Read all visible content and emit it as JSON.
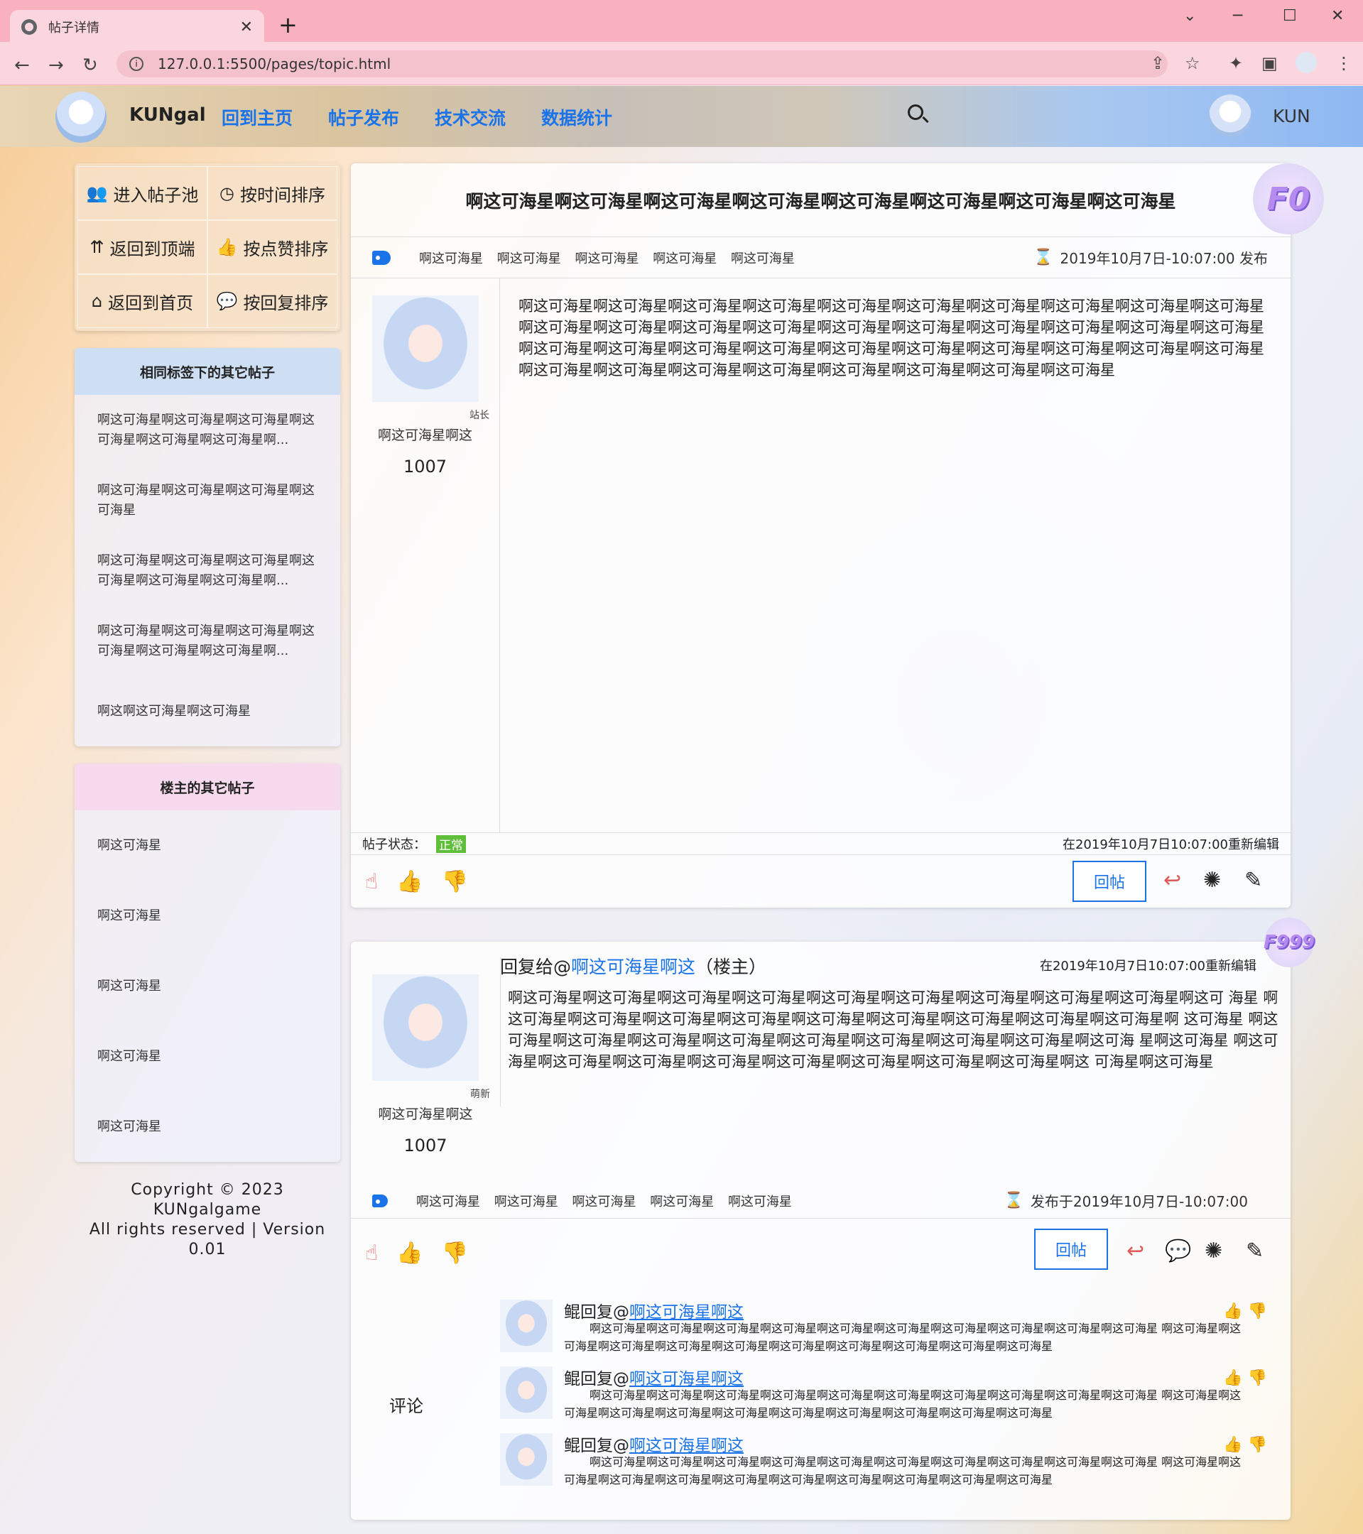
{
  "browser": {
    "tab_title": "帖子详情",
    "url": "127.0.0.1:5500/pages/topic.html"
  },
  "header": {
    "brand": "KUNgal",
    "nav": [
      "回到主页",
      "帖子发布",
      "技术交流",
      "数据统计"
    ],
    "user": "KUN"
  },
  "sidebar": {
    "actions": [
      "进入帖子池",
      "按时间排序",
      "返回到顶端",
      "按点赞排序",
      "返回到首页",
      "按回复排序"
    ],
    "same_tag_title": "相同标签下的其它帖子",
    "same_tag_posts": [
      "啊这可海星啊这可海星啊这可海星啊这可海星啊这可海星啊这可海星啊...",
      "啊这可海星啊这可海星啊这可海星啊这可海星",
      "啊这可海星啊这可海星啊这可海星啊这可海星啊这可海星啊这可海星啊...",
      "啊这可海星啊这可海星啊这可海星啊这可海星啊这可海星啊这可海星啊...",
      "啊这啊这可海星啊这可海星"
    ],
    "owner_title": "楼主的其它帖子",
    "owner_posts": [
      "啊这可海星",
      "啊这可海星",
      "啊这可海星",
      "啊这可海星",
      "啊这可海星"
    ],
    "copyright": [
      "Copyright © 2023 KUNgalgame",
      "All rights reserved | Version 0.01"
    ]
  },
  "post": {
    "title": "啊这可海星啊这可海星啊这可海星啊这可海星啊这可海星啊这可海星啊这可海星啊这可海星",
    "floor": "F0",
    "tags": [
      "啊这可海星",
      "啊这可海星",
      "啊这可海星",
      "啊这可海星",
      "啊这可海星"
    ],
    "date": "2019年10月7日-10:07:00 发布",
    "author_role": "站长",
    "author_name": "啊这可海星啊这",
    "author_num": "1007",
    "content": "啊这可海星啊这可海星啊这可海星啊这可海星啊这可海星啊这可海星啊这可海星啊这可海星啊这可海星啊这可海星 啊这可海星啊这可海星啊这可海星啊这可海星啊这可海星啊这可海星啊这可海星啊这可海星啊这可海星啊这可海星 啊这可海星啊这可海星啊这可海星啊这可海星啊这可海星啊这可海星啊这可海星啊这可海星啊这可海星啊这可海星 啊这可海星啊这可海星啊这可海星啊这可海星啊这可海星啊这可海星啊这可海星啊这可海星",
    "status_label": "帖子状态：",
    "status": "正常",
    "edited": "在2019年10月7日10:07:00重新编辑",
    "reply_label": "回帖"
  },
  "reply": {
    "floor": "F999",
    "prefix": "回复给@",
    "target": "啊这可海星啊这",
    "suffix": "（楼主）",
    "edited": "在2019年10月7日10:07:00重新编辑",
    "author_role": "萌新",
    "author_name": "啊这可海星啊这",
    "author_num": "1007",
    "content": "啊这可海星啊这可海星啊这可海星啊这可海星啊这可海星啊这可海星啊这可海星啊这可海星啊这可海星啊这可 海星 啊这可海星啊这可海星啊这可海星啊这可海星啊这可海星啊这可海星啊这可海星啊这可海星啊这可海星啊 这可海星 啊这可海星啊这可海星啊这可海星啊这可海星啊这可海星啊这可海星啊这可海星啊这可海星啊这可海 星啊这可海星 啊这可海星啊这可海星啊这可海星啊这可海星啊这可海星啊这可海星啊这可海星啊这可海星啊这 可海星啊这可海星",
    "tags": [
      "啊这可海星",
      "啊这可海星",
      "啊这可海星",
      "啊这可海星",
      "啊这可海星"
    ],
    "date": "发布于2019年10月7日-10:07:00",
    "reply_label": "回帖",
    "comment_label": "评论",
    "comments": [
      {
        "user": "鲲回复@",
        "target": "啊这可海星啊这",
        "text": "啊这可海星啊这可海星啊这可海星啊这可海星啊这可海星啊这可海星啊这可海星啊这可海星啊这可海星啊这可海星 啊这可海星啊这可海星啊这可海星啊这可海星啊这可海星啊这可海星啊这可海星啊这可海星啊这可海星啊这可海星"
      },
      {
        "user": "鲲回复@",
        "target": "啊这可海星啊这",
        "text": "啊这可海星啊这可海星啊这可海星啊这可海星啊这可海星啊这可海星啊这可海星啊这可海星啊这可海星啊这可海星 啊这可海星啊这可海星啊这可海星啊这可海星啊这可海星啊这可海星啊这可海星啊这可海星啊这可海星啊这可海星"
      },
      {
        "user": "鲲回复@",
        "target": "啊这可海星啊这",
        "text": "啊这可海星啊这可海星啊这可海星啊这可海星啊这可海星啊这可海星啊这可海星啊这可海星啊这可海星啊这可海星 啊这可海星啊这可海星啊这可海星啊这可海星啊这可海星啊这可海星啊这可海星啊这可海星啊这可海星啊这可海星"
      }
    ]
  }
}
